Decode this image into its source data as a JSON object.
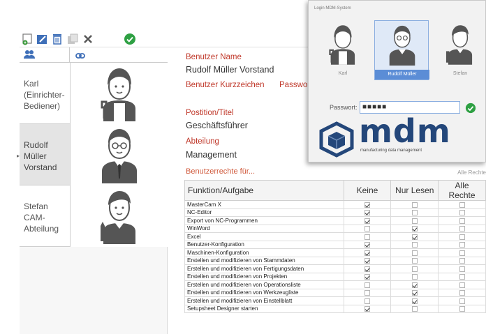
{
  "colors": {
    "accent": "#5b8dd6",
    "label_red": "#c0392b",
    "brand_blue": "#24477a",
    "ok_green": "#2ea043"
  },
  "toolbar": {
    "icons": [
      "add-user-icon",
      "edit-icon",
      "delete-icon",
      "copy-icon",
      "close-icon",
      "ok-icon"
    ]
  },
  "user_list": {
    "header_icons": [
      "users-icon",
      "link-icon"
    ],
    "users": [
      {
        "name": "Karl (Einrichter-Bediener)",
        "avatar": "worker-avatar"
      },
      {
        "name": "Rudolf Müller Vorstand",
        "avatar": "manager-avatar"
      },
      {
        "name": "Stefan CAM-Abteilung",
        "avatar": "designer-avatar"
      }
    ],
    "selected_index": 1
  },
  "detail": {
    "username_label": "Benutzer Name",
    "username_value": "Rudolf Müller Vorstand",
    "shortcode_label": "Benutzer Kurzzeichen",
    "password_label": "Passwort",
    "position_label": "Postition/Titel",
    "position_value": "Geschäftsführer",
    "department_label": "Abteilung",
    "department_value": "Management",
    "rights_label": "Benutzerrechte für...",
    "rights_hint": "Alle Rechte"
  },
  "rights_table": {
    "headers": [
      "Funktion/Aufgabe",
      "Keine",
      "Nur Lesen",
      "Alle Rechte"
    ],
    "rows": [
      {
        "name": "MasterCam X",
        "keine": true,
        "lesen": false,
        "alle": false
      },
      {
        "name": "NC-Editor",
        "keine": true,
        "lesen": false,
        "alle": false
      },
      {
        "name": "Export von NC-Programmen",
        "keine": true,
        "lesen": false,
        "alle": false
      },
      {
        "name": "WinWord",
        "keine": false,
        "lesen": true,
        "alle": false
      },
      {
        "name": "Excel",
        "keine": false,
        "lesen": true,
        "alle": false
      },
      {
        "name": "Benutzer-Konfiguration",
        "keine": true,
        "lesen": false,
        "alle": false
      },
      {
        "name": "Maschinen-Konfiguration",
        "keine": true,
        "lesen": false,
        "alle": false
      },
      {
        "name": "Erstellen und modifizieren von Stammdaten",
        "keine": true,
        "lesen": false,
        "alle": false
      },
      {
        "name": "Erstellen und modifizieren von Fertigungsdaten",
        "keine": true,
        "lesen": false,
        "alle": false
      },
      {
        "name": "Erstellen und modifizieren von Projekten",
        "keine": true,
        "lesen": false,
        "alle": false
      },
      {
        "name": "Erstellen und modifizieren von Operationsliste",
        "keine": false,
        "lesen": true,
        "alle": false
      },
      {
        "name": "Erstellen und modifizieren von Werkzeugliste",
        "keine": false,
        "lesen": true,
        "alle": false
      },
      {
        "name": "Erstellen und modifizieren von Einstellblatt",
        "keine": false,
        "lesen": true,
        "alle": false
      },
      {
        "name": "Setupsheet Designer starten",
        "keine": true,
        "lesen": false,
        "alle": false
      }
    ]
  },
  "login": {
    "title": "Login MDM-System",
    "users": [
      {
        "name": "Karl",
        "avatar": "worker-avatar"
      },
      {
        "name": "Rudolf Müller",
        "avatar": "manager-avatar"
      },
      {
        "name": "Stefan",
        "avatar": "designer-avatar"
      }
    ],
    "selected_index": 1,
    "password_label": "Passwort:",
    "password_value": "■■■■■",
    "brand": "mdm",
    "brand_subtitle": "manufacturing data management"
  }
}
